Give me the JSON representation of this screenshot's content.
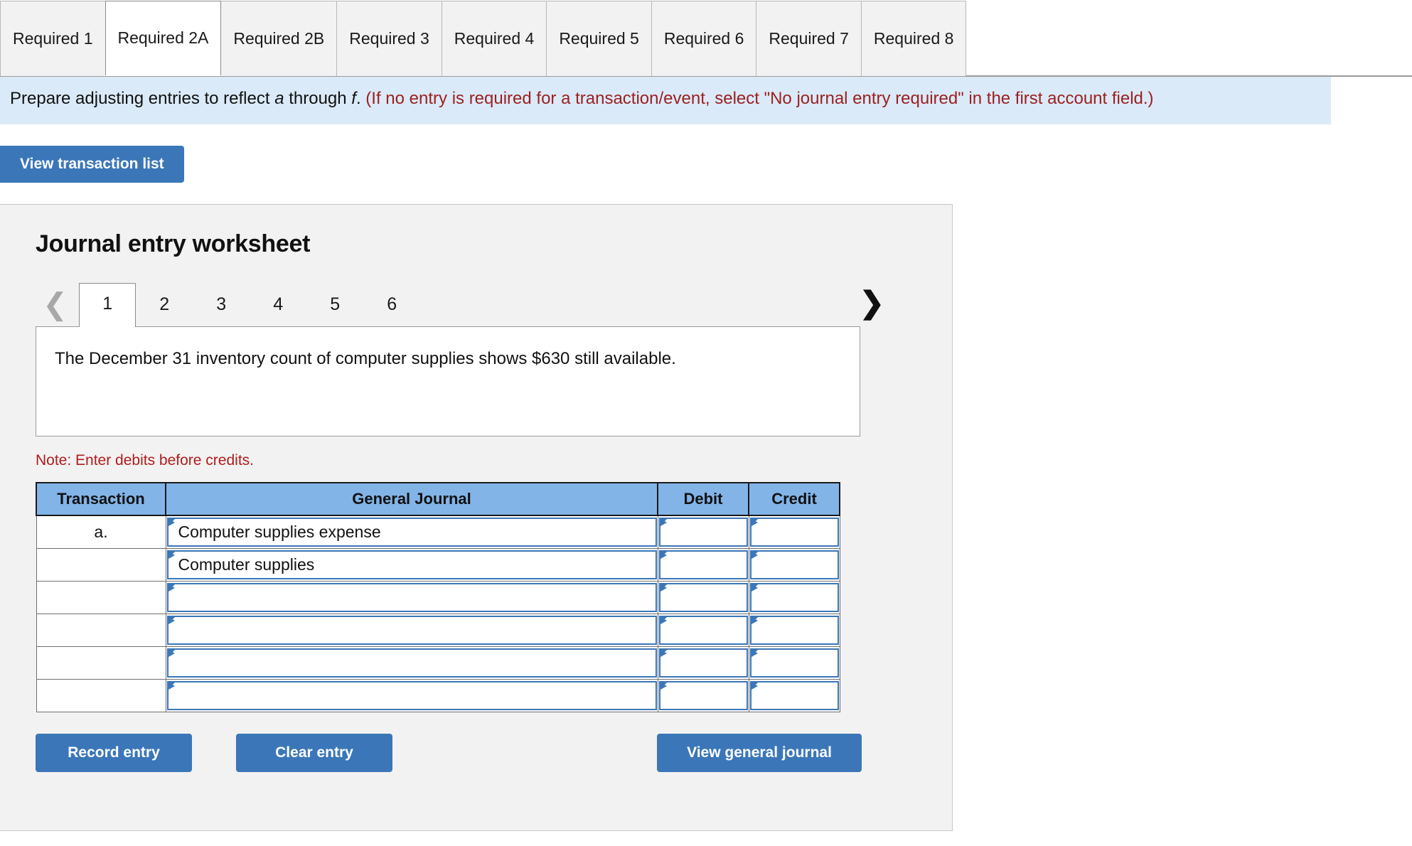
{
  "requirement_tabs": [
    {
      "label": "Required 1",
      "active": false
    },
    {
      "label": "Required 2A",
      "active": true
    },
    {
      "label": "Required 2B",
      "active": false
    },
    {
      "label": "Required 3",
      "active": false
    },
    {
      "label": "Required 4",
      "active": false
    },
    {
      "label": "Required 5",
      "active": false
    },
    {
      "label": "Required 6",
      "active": false
    },
    {
      "label": "Required 7",
      "active": false
    },
    {
      "label": "Required 8",
      "active": false
    }
  ],
  "instruction": {
    "lead_1": "Prepare adjusting entries to reflect ",
    "italic_1": "a",
    "lead_2": " through ",
    "italic_2": "f",
    "lead_3": ".",
    "red": " (If no entry is required for a transaction/event, select \"No journal entry required\" in the first account field.)"
  },
  "toolbar": {
    "view_transaction_list_label": "View transaction list"
  },
  "worksheet": {
    "title": "Journal entry worksheet",
    "pager": {
      "prev_icon": "chevron-left-icon",
      "next_icon": "chevron-right-icon",
      "pages": [
        "1",
        "2",
        "3",
        "4",
        "5",
        "6"
      ],
      "active_page": "1"
    },
    "transaction_description": "The December 31 inventory count of computer supplies shows $630 still available.",
    "debit_note": "Note: Enter debits before credits.",
    "table": {
      "headers": {
        "transaction": "Transaction",
        "general_journal": "General Journal",
        "debit": "Debit",
        "credit": "Credit"
      },
      "rows": [
        {
          "transaction": "a.",
          "account": "Computer supplies expense",
          "debit": "",
          "credit": ""
        },
        {
          "transaction": "",
          "account": "Computer supplies",
          "debit": "",
          "credit": ""
        },
        {
          "transaction": "",
          "account": "",
          "debit": "",
          "credit": ""
        },
        {
          "transaction": "",
          "account": "",
          "debit": "",
          "credit": ""
        },
        {
          "transaction": "",
          "account": "",
          "debit": "",
          "credit": ""
        },
        {
          "transaction": "",
          "account": "",
          "debit": "",
          "credit": ""
        }
      ]
    },
    "actions": {
      "record_entry_label": "Record entry",
      "clear_entry_label": "Clear entry",
      "view_general_journal_label": "View general journal"
    }
  },
  "colors": {
    "accent_blue": "#3b77b8",
    "banner_blue": "#daeaf8",
    "table_header_blue": "#82b4e8",
    "note_red": "#b01c1c",
    "instruction_red": "#9c2020",
    "panel_gray": "#f2f2f2"
  }
}
